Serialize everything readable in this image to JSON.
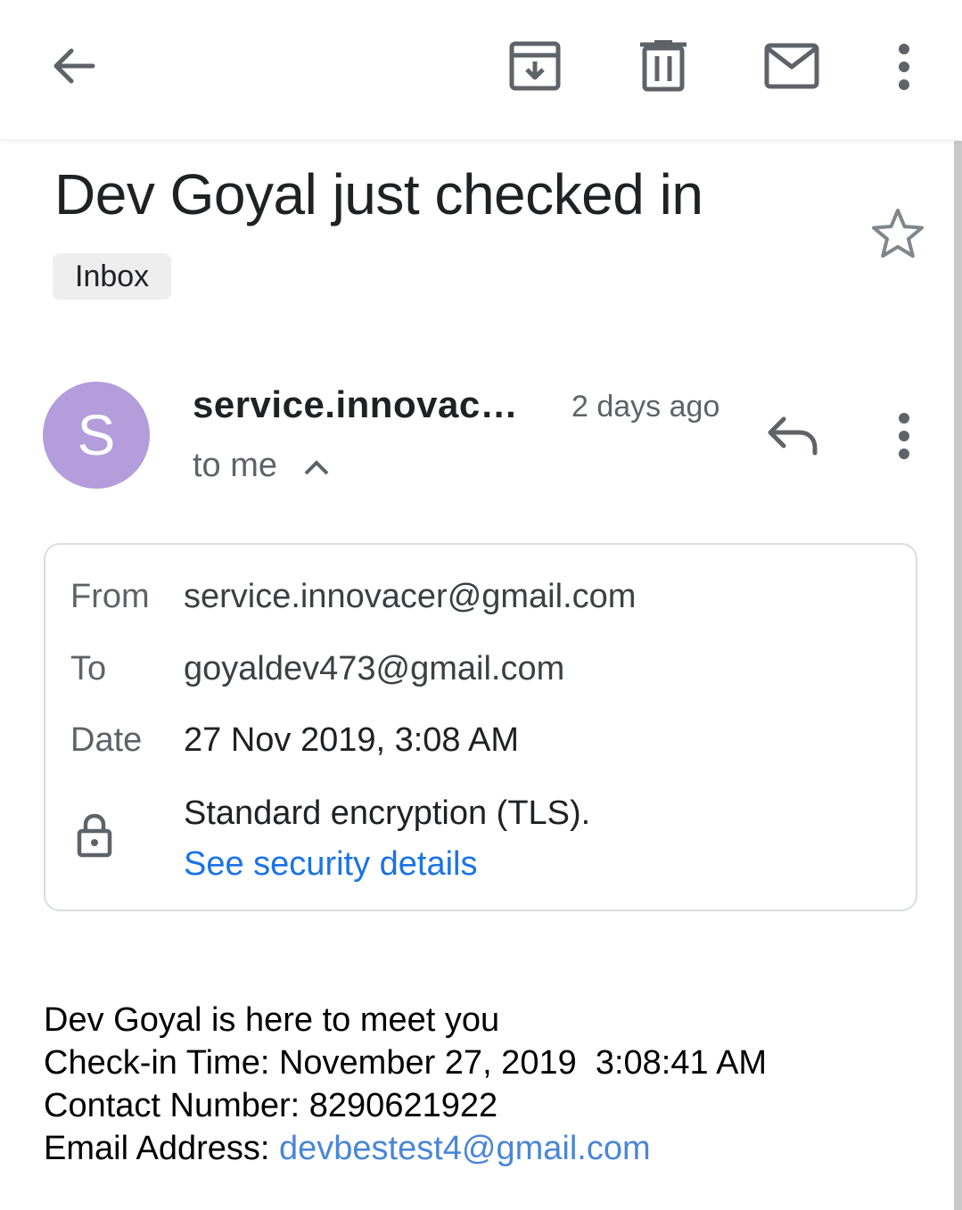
{
  "toolbar": {
    "back_icon": "arrow-back-icon",
    "archive_icon": "archive-icon",
    "delete_icon": "trash-icon",
    "mark_unread_icon": "mail-icon",
    "more_icon": "more-vert-icon"
  },
  "message": {
    "subject": "Dev Goyal just checked in",
    "label": "Inbox",
    "starred": false,
    "avatar_letter": "S",
    "avatar_color": "#b39ddb",
    "sender": "service.innovac…",
    "time": "2 days ago",
    "recipients": "to me"
  },
  "details": {
    "from_label": "From",
    "from_value": "service.innovacer@gmail.com",
    "to_label": "To",
    "to_value": "goyaldev473@gmail.com",
    "date_label": "Date",
    "date_value": "27 Nov 2019, 3:08 AM",
    "security_text": "Standard encryption (TLS).",
    "security_link": "See security details"
  },
  "body": {
    "line1": "Dev Goyal is here to meet you",
    "line2": "Check-in Time: November 27, 2019  3:08:41 AM",
    "line3": "Contact Number: 8290621922",
    "line4_prefix": "Email Address: ",
    "line4_email": "devbestest4@gmail.com"
  },
  "colors": {
    "accent_link": "#1a73e8",
    "icon_gray": "#5f6368"
  }
}
